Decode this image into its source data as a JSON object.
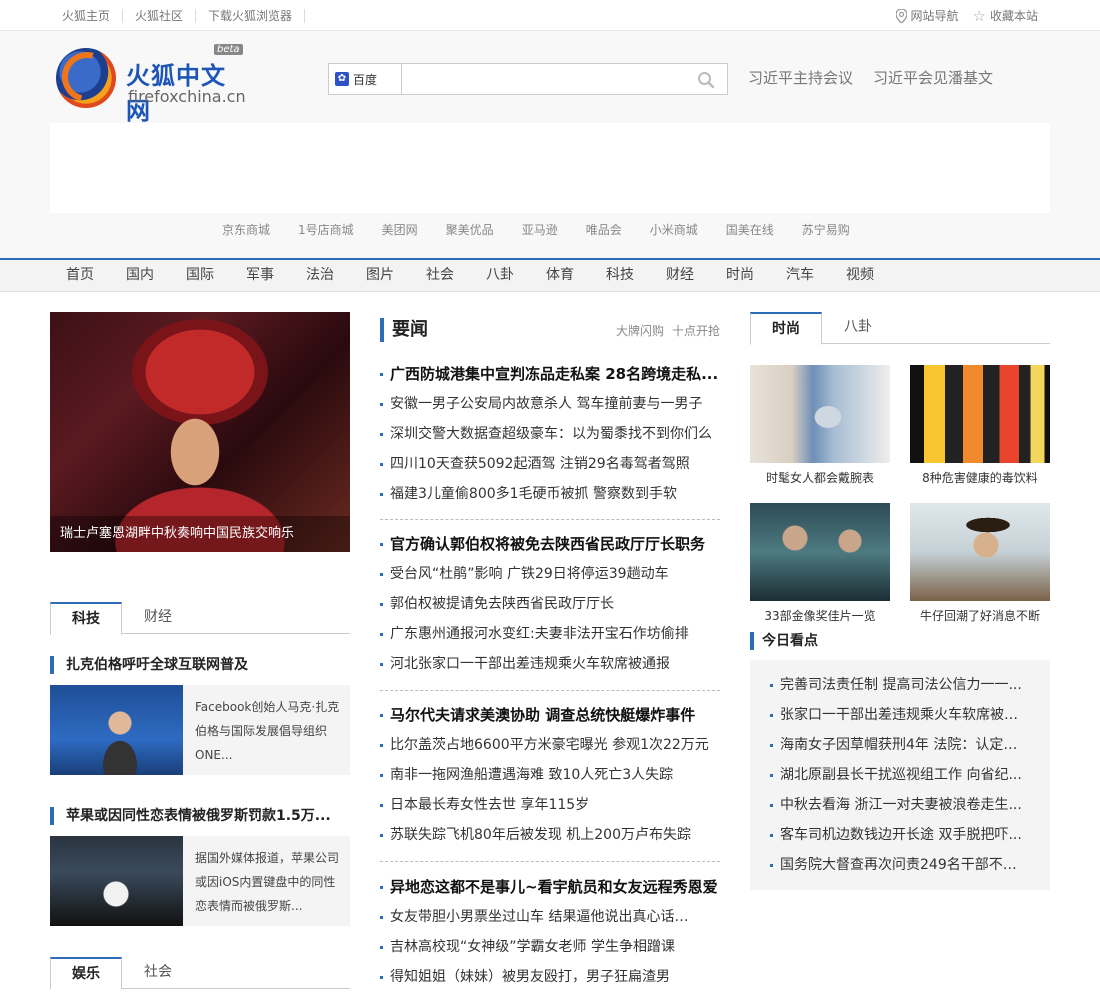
{
  "topbar": {
    "links": [
      "火狐主页",
      "火狐社区",
      "下载火狐浏览器"
    ],
    "nav_site": "网站导航",
    "bookmark": "收藏本站"
  },
  "logo": {
    "name_cn": "火狐中文网",
    "domain": "firefoxchina.cn",
    "badge": "beta"
  },
  "search": {
    "engine": "百度",
    "value": "",
    "placeholder": ""
  },
  "hotwords": [
    "习近平主持会议",
    "习近平会见潘基文"
  ],
  "shops": [
    "京东商城",
    "1号店商城",
    "美团网",
    "聚美优品",
    "亚马逊",
    "唯品会",
    "小米商城",
    "国美在线",
    "苏宁易购"
  ],
  "nav": [
    "首页",
    "国内",
    "国际",
    "军事",
    "法治",
    "图片",
    "社会",
    "八卦",
    "体育",
    "科技",
    "财经",
    "时尚",
    "汽车",
    "视频"
  ],
  "hero": {
    "caption": "瑞士卢塞恩湖畔中秋奏响中国民族交响乐"
  },
  "left_tabs1": [
    "科技",
    "财经"
  ],
  "left_tabs2": [
    "娱乐",
    "社会"
  ],
  "tech": [
    {
      "title": "扎克伯格呼吁全球互联网普及",
      "desc": "Facebook创始人马克·扎克伯格与国际发展倡导组织ONE..."
    },
    {
      "title": "苹果或因同性恋表情被俄罗斯罚款1.5万...",
      "desc": "据国外媒体报道，苹果公司或因iOS内置键盘中的同性恋表情而被俄罗斯..."
    }
  ],
  "middle": {
    "title": "要闻",
    "more": [
      "大牌闪购",
      "十点开抢"
    ],
    "groups": [
      [
        "广西防城港集中宣判冻品走私案  28名跨境走私...",
        "安徽一男子公安局内故意杀人  驾车撞前妻与一男子",
        "深圳交警大数据查超级豪车：以为蜀黍找不到你们么",
        "四川10天查获5092起酒驾  注销29名毒驾者驾照",
        "福建3儿童偷800多1毛硬币被抓  警察数到手软"
      ],
      [
        "官方确认郭伯权将被免去陕西省民政厅厅长职务",
        "受台风“杜鹃”影响  广铁29日将停运39趟动车",
        "郭伯权被提请免去陕西省民政厅厅长",
        "广东惠州通报河水变红:夫妻非法开宝石作坊偷排",
        "河北张家口一干部出差违规乘火车软席被通报"
      ],
      [
        "马尔代夫请求美澳协助  调查总统快艇爆炸事件",
        "比尔盖茨占地6600平方米豪宅曝光  参观1次22万元",
        "南非一拖网渔船遭遇海难  致10人死亡3人失踪",
        "日本最长寿女性去世  享年115岁",
        "苏联失踪飞机80年后被发现  机上200万卢布失踪"
      ],
      [
        "异地恋这都不是事儿~看宇航员和女友远程秀恩爱",
        "女友带胆小男票坐过山车  结果逼他说出真心话…",
        "吉林高校现“女神级”学霸女老师  学生争相蹭课",
        "得知姐姐（妹妹）被男友殴打，男子狂扁渣男"
      ]
    ]
  },
  "right_tabs": [
    "时尚",
    "八卦"
  ],
  "fashion": [
    "时髦女人都会戴腕表",
    "8种危害健康的毒饮料",
    "33部金像奖佳片一览",
    "牛仔回潮了好消息不断"
  ],
  "today": {
    "title": "今日看点",
    "items": [
      "完善司法责任制   提高司法公信力一一...",
      "张家口一干部出差违规乘火车软席被通...",
      "海南女子因草帽获刑4年  法院：认定事...",
      "湖北原副县长干扰巡视组工作  向省纪...",
      "中秋去看海  浙江一对夫妻被浪卷走生...",
      "客车司机边数钱边开长途  双手脱把吓...",
      "国务院大督查再次问责249名干部不作为"
    ]
  }
}
